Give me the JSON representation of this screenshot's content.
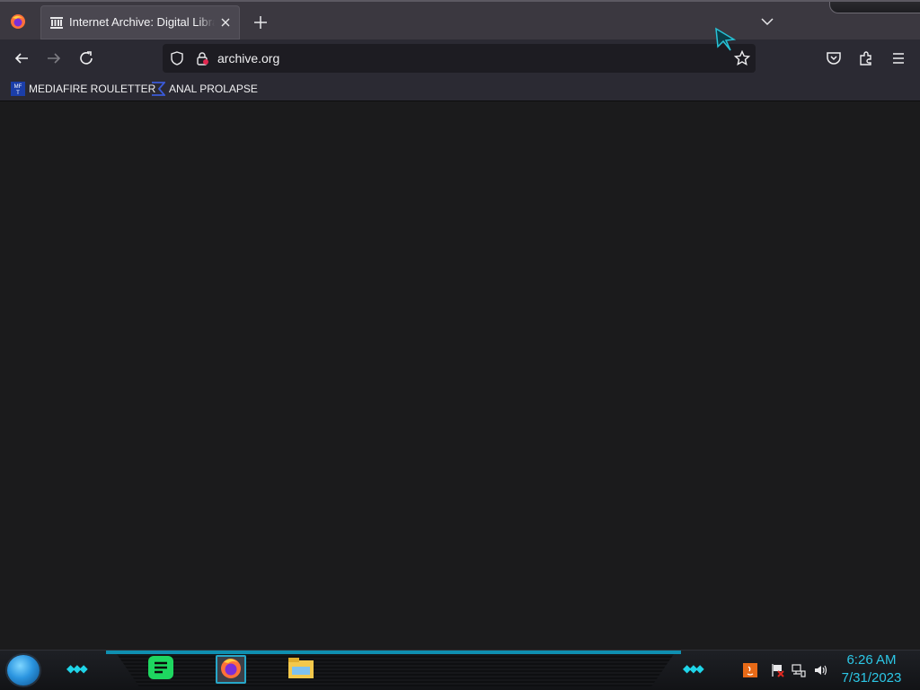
{
  "browser": {
    "tab": {
      "title": "Internet Archive: Digital Library",
      "icon": "library-columns-icon"
    },
    "url": "archive.org",
    "bookmarks": [
      {
        "label": "MEDIAFIRE ROULETTER",
        "icon": "mediafire-icon",
        "icon_text": "MF T"
      },
      {
        "label": "ANAL PROLAPSE",
        "icon": "sigma-icon"
      }
    ]
  },
  "taskbar": {
    "apps": [
      "spotify-icon",
      "firefox-icon",
      "file-explorer-icon"
    ],
    "tray": [
      "java-icon",
      "flag-icon",
      "network-icon",
      "volume-icon"
    ],
    "clock": {
      "time": "6:26 AM",
      "date": "7/31/2023"
    }
  },
  "colors": {
    "tabstrip": "#3b3840",
    "toolbar": "#2b2a33",
    "content": "#1b1b1c",
    "accent": "#2cc7e6"
  }
}
